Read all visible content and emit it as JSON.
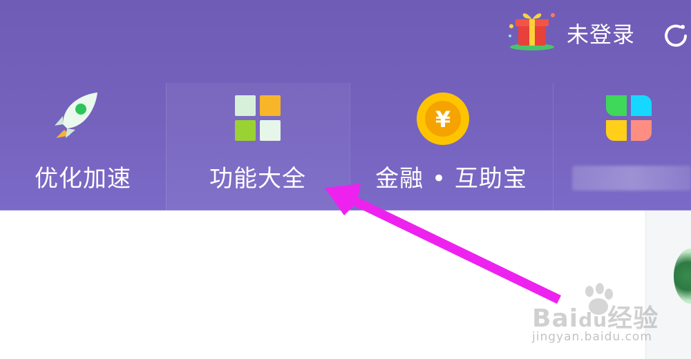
{
  "header": {
    "login_status": "未登录",
    "gift_icon": "gift-box-icon",
    "refresh_icon": "refresh-icon"
  },
  "nav": {
    "items": [
      {
        "label": "优化加速",
        "icon": "rocket-icon"
      },
      {
        "label": "功能大全",
        "icon": "app-grid-icon",
        "active": true
      },
      {
        "label": "金融 • 互助宝",
        "icon": "yuan-coin-icon"
      },
      {
        "label": "",
        "icon": "clover-tiles-icon"
      }
    ]
  },
  "colors": {
    "header_bg": "#7462bd",
    "arrow": "#ee22ee",
    "coin": "#ffc400"
  },
  "watermark": {
    "brand": "Bai",
    "brand_tail": "经验",
    "url": "jingyan.baidu.com"
  }
}
